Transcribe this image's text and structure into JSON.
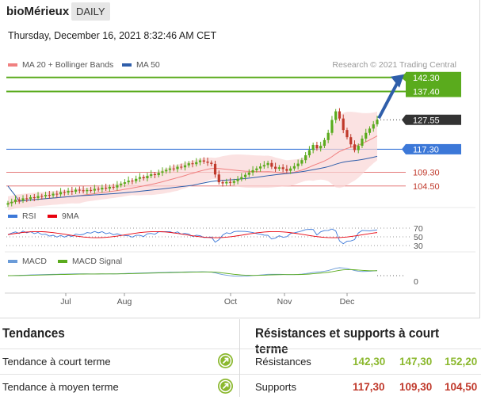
{
  "header": {
    "ticker": "bioMérieux",
    "period": "DAILY",
    "datetime": "Thursday, December 16, 2021 8:32:46 AM CET",
    "research": "Research © 2021 Trading Central"
  },
  "legend": {
    "ma20": "MA 20 + Bollinger Bands",
    "ma50": "MA 50",
    "rsi": "RSI",
    "rsi_ma": "9MA",
    "macd": "MACD",
    "macd_signal": "MACD Signal"
  },
  "colors": {
    "ma20": "#f08080",
    "ma50": "#2f5eaa",
    "resistance": "#5aab1d",
    "support_primary": "#3c78d8",
    "support_secondary": "#e06666",
    "last_price": "#333333",
    "up_candle": "#5aab1d",
    "down_candle": "#c0392b",
    "macd_line": "#6a9bd8",
    "macd_signal_line": "#5aab1d",
    "trend_icon": "#8bb82e"
  },
  "price_levels": {
    "resistance_labels": [
      "142.30",
      "137.40"
    ],
    "last_price": "127.55",
    "support_labels": [
      "117.30",
      "109.30",
      "104.50"
    ]
  },
  "indicators": {
    "rsi_levels": [
      "70",
      "50",
      "30"
    ],
    "macd_zero": "0"
  },
  "x_axis": [
    "Jul",
    "Aug",
    "Oct",
    "Nov",
    "Dec"
  ],
  "chart_data": {
    "type": "candlestick",
    "title": "bioMérieux",
    "interval": "DAILY",
    "ylim": [
      97,
      145
    ],
    "resistances": [
      142.3,
      137.4
    ],
    "supports": [
      117.3,
      109.3,
      104.5
    ],
    "last_price": 127.55,
    "close": [
      98.5,
      99.0,
      99.8,
      99.4,
      100.2,
      100.0,
      100.6,
      100.3,
      101.0,
      100.9,
      101.4,
      101.2,
      101.8,
      101.6,
      102.4,
      102.2,
      102.8,
      102.5,
      103.2,
      103.0,
      102.7,
      103.1,
      102.9,
      103.5,
      103.3,
      103.9,
      103.6,
      104.2,
      104.0,
      104.8,
      105.3,
      105.8,
      106.4,
      106.2,
      107.0,
      107.6,
      107.2,
      108.0,
      108.6,
      108.3,
      109.1,
      109.6,
      110.1,
      110.6,
      110.4,
      111.2,
      111.0,
      111.7,
      112.4,
      112.1,
      112.8,
      113.4,
      113.0,
      112.6,
      112.2,
      108.5,
      105.8,
      105.4,
      105.9,
      105.6,
      106.2,
      106.9,
      107.6,
      108.4,
      109.2,
      110.0,
      110.6,
      111.3,
      111.8,
      112.5,
      111.2,
      110.5,
      111.0,
      110.4,
      109.8,
      110.6,
      111.4,
      112.3,
      113.5,
      115.2,
      117.0,
      118.8,
      117.6,
      118.5,
      120.5,
      123.0,
      127.5,
      130.5,
      128.0,
      124.0,
      121.5,
      119.0,
      117.0,
      118.5,
      121.0,
      123.0,
      124.5,
      126.0,
      127.55
    ]
  },
  "trends": {
    "title": "Tendances",
    "rows": [
      {
        "label": "Tendance à court terme"
      },
      {
        "label": "Tendance à moyen terme"
      }
    ]
  },
  "levels": {
    "title": "Résistances et supports à court terme",
    "resistances": {
      "label": "Résistances",
      "values": [
        "142,30",
        "147,30",
        "152,20"
      ]
    },
    "supports": {
      "label": "Supports",
      "values": [
        "117,30",
        "109,30",
        "104,50"
      ]
    }
  }
}
